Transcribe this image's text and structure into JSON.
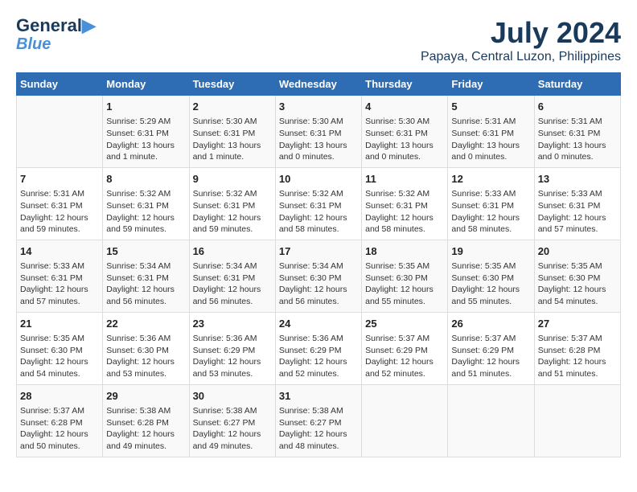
{
  "header": {
    "logo_line1": "General",
    "logo_line2": "Blue",
    "month": "July 2024",
    "location": "Papaya, Central Luzon, Philippines"
  },
  "days_of_week": [
    "Sunday",
    "Monday",
    "Tuesday",
    "Wednesday",
    "Thursday",
    "Friday",
    "Saturday"
  ],
  "weeks": [
    [
      {
        "num": "",
        "info": ""
      },
      {
        "num": "1",
        "info": "Sunrise: 5:29 AM\nSunset: 6:31 PM\nDaylight: 13 hours\nand 1 minute."
      },
      {
        "num": "2",
        "info": "Sunrise: 5:30 AM\nSunset: 6:31 PM\nDaylight: 13 hours\nand 1 minute."
      },
      {
        "num": "3",
        "info": "Sunrise: 5:30 AM\nSunset: 6:31 PM\nDaylight: 13 hours\nand 0 minutes."
      },
      {
        "num": "4",
        "info": "Sunrise: 5:30 AM\nSunset: 6:31 PM\nDaylight: 13 hours\nand 0 minutes."
      },
      {
        "num": "5",
        "info": "Sunrise: 5:31 AM\nSunset: 6:31 PM\nDaylight: 13 hours\nand 0 minutes."
      },
      {
        "num": "6",
        "info": "Sunrise: 5:31 AM\nSunset: 6:31 PM\nDaylight: 13 hours\nand 0 minutes."
      }
    ],
    [
      {
        "num": "7",
        "info": "Sunrise: 5:31 AM\nSunset: 6:31 PM\nDaylight: 12 hours\nand 59 minutes."
      },
      {
        "num": "8",
        "info": "Sunrise: 5:32 AM\nSunset: 6:31 PM\nDaylight: 12 hours\nand 59 minutes."
      },
      {
        "num": "9",
        "info": "Sunrise: 5:32 AM\nSunset: 6:31 PM\nDaylight: 12 hours\nand 59 minutes."
      },
      {
        "num": "10",
        "info": "Sunrise: 5:32 AM\nSunset: 6:31 PM\nDaylight: 12 hours\nand 58 minutes."
      },
      {
        "num": "11",
        "info": "Sunrise: 5:32 AM\nSunset: 6:31 PM\nDaylight: 12 hours\nand 58 minutes."
      },
      {
        "num": "12",
        "info": "Sunrise: 5:33 AM\nSunset: 6:31 PM\nDaylight: 12 hours\nand 58 minutes."
      },
      {
        "num": "13",
        "info": "Sunrise: 5:33 AM\nSunset: 6:31 PM\nDaylight: 12 hours\nand 57 minutes."
      }
    ],
    [
      {
        "num": "14",
        "info": "Sunrise: 5:33 AM\nSunset: 6:31 PM\nDaylight: 12 hours\nand 57 minutes."
      },
      {
        "num": "15",
        "info": "Sunrise: 5:34 AM\nSunset: 6:31 PM\nDaylight: 12 hours\nand 56 minutes."
      },
      {
        "num": "16",
        "info": "Sunrise: 5:34 AM\nSunset: 6:31 PM\nDaylight: 12 hours\nand 56 minutes."
      },
      {
        "num": "17",
        "info": "Sunrise: 5:34 AM\nSunset: 6:30 PM\nDaylight: 12 hours\nand 56 minutes."
      },
      {
        "num": "18",
        "info": "Sunrise: 5:35 AM\nSunset: 6:30 PM\nDaylight: 12 hours\nand 55 minutes."
      },
      {
        "num": "19",
        "info": "Sunrise: 5:35 AM\nSunset: 6:30 PM\nDaylight: 12 hours\nand 55 minutes."
      },
      {
        "num": "20",
        "info": "Sunrise: 5:35 AM\nSunset: 6:30 PM\nDaylight: 12 hours\nand 54 minutes."
      }
    ],
    [
      {
        "num": "21",
        "info": "Sunrise: 5:35 AM\nSunset: 6:30 PM\nDaylight: 12 hours\nand 54 minutes."
      },
      {
        "num": "22",
        "info": "Sunrise: 5:36 AM\nSunset: 6:30 PM\nDaylight: 12 hours\nand 53 minutes."
      },
      {
        "num": "23",
        "info": "Sunrise: 5:36 AM\nSunset: 6:29 PM\nDaylight: 12 hours\nand 53 minutes."
      },
      {
        "num": "24",
        "info": "Sunrise: 5:36 AM\nSunset: 6:29 PM\nDaylight: 12 hours\nand 52 minutes."
      },
      {
        "num": "25",
        "info": "Sunrise: 5:37 AM\nSunset: 6:29 PM\nDaylight: 12 hours\nand 52 minutes."
      },
      {
        "num": "26",
        "info": "Sunrise: 5:37 AM\nSunset: 6:29 PM\nDaylight: 12 hours\nand 51 minutes."
      },
      {
        "num": "27",
        "info": "Sunrise: 5:37 AM\nSunset: 6:28 PM\nDaylight: 12 hours\nand 51 minutes."
      }
    ],
    [
      {
        "num": "28",
        "info": "Sunrise: 5:37 AM\nSunset: 6:28 PM\nDaylight: 12 hours\nand 50 minutes."
      },
      {
        "num": "29",
        "info": "Sunrise: 5:38 AM\nSunset: 6:28 PM\nDaylight: 12 hours\nand 49 minutes."
      },
      {
        "num": "30",
        "info": "Sunrise: 5:38 AM\nSunset: 6:27 PM\nDaylight: 12 hours\nand 49 minutes."
      },
      {
        "num": "31",
        "info": "Sunrise: 5:38 AM\nSunset: 6:27 PM\nDaylight: 12 hours\nand 48 minutes."
      },
      {
        "num": "",
        "info": ""
      },
      {
        "num": "",
        "info": ""
      },
      {
        "num": "",
        "info": ""
      }
    ]
  ]
}
